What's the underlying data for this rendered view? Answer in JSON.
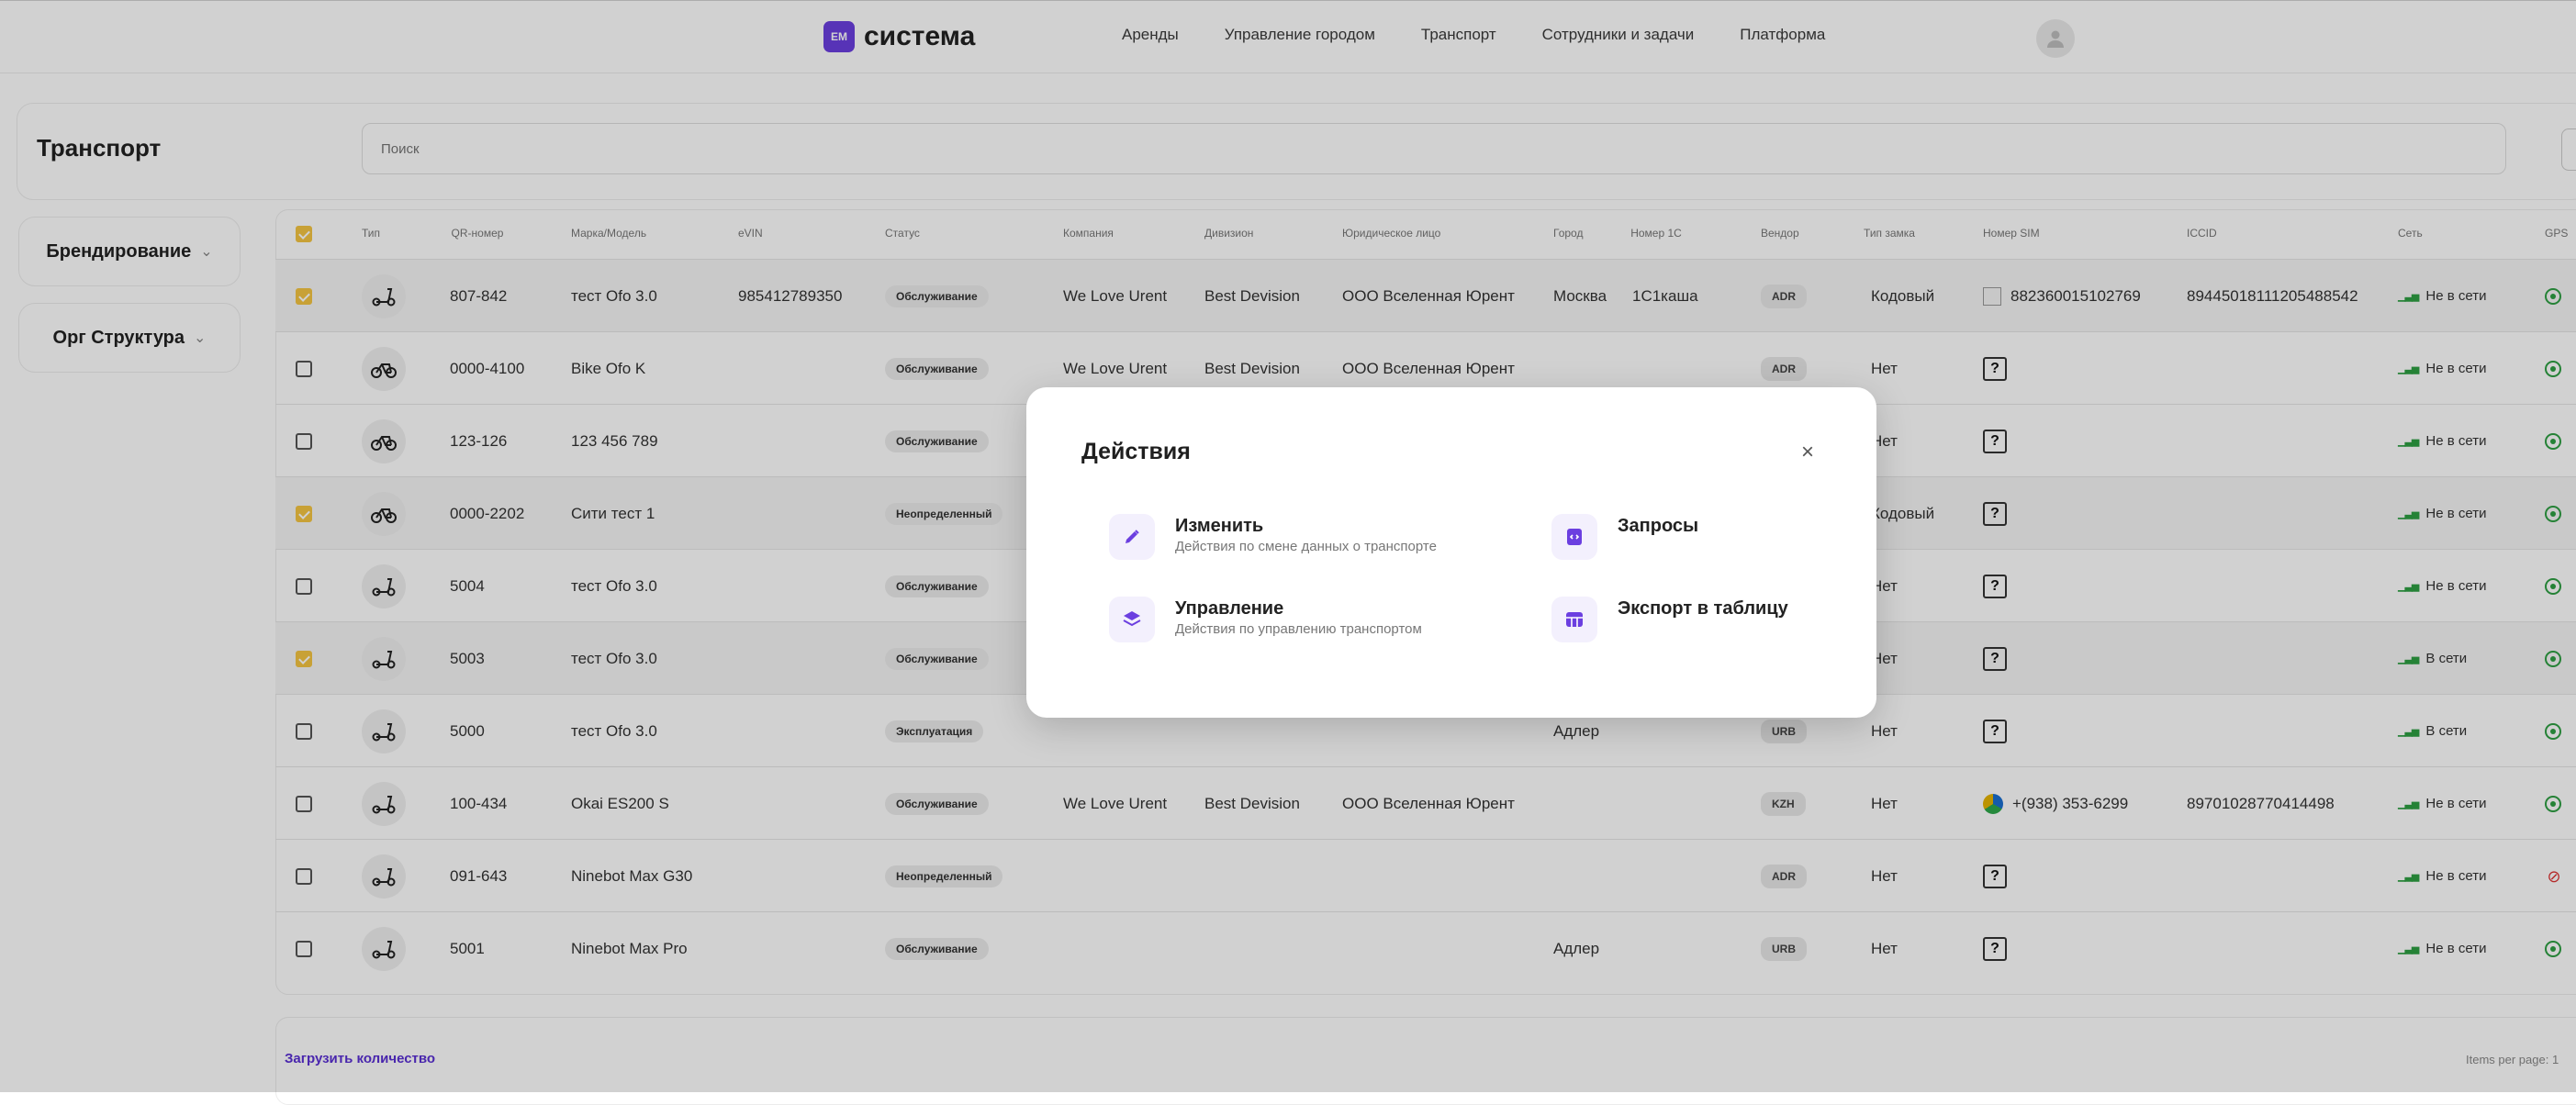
{
  "app": {
    "logo_badge": "EM",
    "logo_text": "система"
  },
  "nav": [
    "Аренды",
    "Управление городом",
    "Транспорт",
    "Сотрудники и задачи",
    "Платформа"
  ],
  "page": {
    "title": "Транспорт",
    "search_placeholder": "Поиск"
  },
  "sidebar": [
    {
      "label": "Брендирование"
    },
    {
      "label": "Орг Структура"
    }
  ],
  "columns": {
    "type": "Тип",
    "qr": "QR-номер",
    "model": "Марка/Модель",
    "evin": "eVIN",
    "status": "Статус",
    "company": "Компания",
    "division": "Дивизион",
    "legal": "Юридическое лицо",
    "city": "Город",
    "num1c": "Номер 1С",
    "vendor": "Вендор",
    "lock": "Тип замка",
    "sim": "Номер SIM",
    "iccid": "ICCID",
    "network": "Сеть",
    "gps": "GPS"
  },
  "rows": [
    {
      "selected": true,
      "icon": "scooter-icon",
      "qr": "807-842",
      "model": "тест Ofo 3.0",
      "evin": "985412789350",
      "status": "Обслуживание",
      "company": "We Love Urent",
      "division": "Best Devision",
      "legal": "ООО Вселенная Юрент",
      "city": "Москва",
      "num1c": "1С1каша",
      "vendor": "ADR",
      "lock": "Кодовый",
      "sim_kind": "image",
      "sim": "882360015102769",
      "iccid": "89445018111205488542",
      "network": "Не в сети",
      "gps": "on"
    },
    {
      "selected": false,
      "icon": "bike-icon",
      "qr": "0000-4100",
      "model": "Bike Ofo K",
      "evin": "",
      "status": "Обслуживание",
      "company": "We Love Urent",
      "division": "Best Devision",
      "legal": "ООО Вселенная Юрент",
      "city": "",
      "num1c": "",
      "vendor": "ADR",
      "lock": "Нет",
      "sim_kind": "unknown",
      "sim": "?",
      "iccid": "",
      "network": "Не в сети",
      "gps": "on"
    },
    {
      "selected": false,
      "icon": "bike-icon",
      "qr": "123-126",
      "model": "123 456 789",
      "evin": "",
      "status": "Обслуживание",
      "company": "",
      "division": "",
      "legal": "",
      "city": "",
      "num1c": "",
      "vendor": "",
      "lock": "Нет",
      "sim_kind": "unknown",
      "sim": "?",
      "iccid": "",
      "network": "Не в сети",
      "gps": "on"
    },
    {
      "selected": true,
      "icon": "bike-icon",
      "qr": "0000-2202",
      "model": "Сити тест 1",
      "evin": "",
      "status": "Неопределенный",
      "company": "",
      "division": "",
      "legal": "",
      "city": "",
      "num1c": "",
      "vendor": "",
      "lock": "Кодовый",
      "sim_kind": "unknown",
      "sim": "?",
      "iccid": "",
      "network": "Не в сети",
      "gps": "on"
    },
    {
      "selected": false,
      "icon": "scooter-icon",
      "qr": "5004",
      "model": "тест Ofo 3.0",
      "evin": "",
      "status": "Обслуживание",
      "company": "",
      "division": "",
      "legal": "",
      "city": "",
      "num1c": "",
      "vendor": "",
      "lock": "Нет",
      "sim_kind": "unknown",
      "sim": "?",
      "iccid": "",
      "network": "Не в сети",
      "gps": "on"
    },
    {
      "selected": true,
      "icon": "scooter-icon",
      "qr": "5003",
      "model": "тест Ofo 3.0",
      "evin": "",
      "status": "Обслуживание",
      "company": "",
      "division": "",
      "legal": "",
      "city": "",
      "num1c": "",
      "vendor": "",
      "lock": "Нет",
      "sim_kind": "unknown",
      "sim": "?",
      "iccid": "",
      "network": "В сети",
      "gps": "on"
    },
    {
      "selected": false,
      "icon": "scooter-icon",
      "qr": "5000",
      "model": "тест Ofo 3.0",
      "evin": "",
      "status": "Эксплуатация",
      "company": "",
      "division": "",
      "legal": "",
      "city": "Адлер",
      "num1c": "",
      "vendor": "URB",
      "lock": "Нет",
      "sim_kind": "unknown",
      "sim": "?",
      "iccid": "",
      "network": "В сети",
      "gps": "on"
    },
    {
      "selected": false,
      "icon": "scooter-icon",
      "qr": "100-434",
      "model": "Okai ES200 S",
      "evin": "",
      "status": "Обслуживание",
      "company": "We Love Urent",
      "division": "Best Devision",
      "legal": "ООО Вселенная Юрент",
      "city": "",
      "num1c": "",
      "vendor": "KZH",
      "lock": "Нет",
      "sim_kind": "flag",
      "sim": "+(938) 353-6299",
      "iccid": "89701028770414498",
      "network": "Не в сети",
      "gps": "on"
    },
    {
      "selected": false,
      "icon": "scooter-icon",
      "qr": "091-643",
      "model": "Ninebot Max G30",
      "evin": "",
      "status": "Неопределенный",
      "company": "",
      "division": "",
      "legal": "",
      "city": "",
      "num1c": "",
      "vendor": "ADR",
      "lock": "Нет",
      "sim_kind": "unknown",
      "sim": "?",
      "iccid": "",
      "network": "Не в сети",
      "gps": "off"
    },
    {
      "selected": false,
      "icon": "scooter-icon",
      "qr": "5001",
      "model": "Ninebot Max Pro",
      "evin": "",
      "status": "Обслуживание",
      "company": "",
      "division": "",
      "legal": "",
      "city": "Адлер",
      "num1c": "",
      "vendor": "URB",
      "lock": "Нет",
      "sim_kind": "unknown",
      "sim": "?",
      "iccid": "",
      "network": "Не в сети",
      "gps": "on"
    }
  ],
  "footer": {
    "load_more": "Загрузить количество",
    "items_per_page": "Items per page: 1"
  },
  "modal": {
    "title": "Действия",
    "actions": [
      {
        "title": "Изменить",
        "desc": "Действия по смене данных о транспорте",
        "icon": "pencil-icon"
      },
      {
        "title": "Запросы",
        "desc": "",
        "icon": "code-file-icon"
      },
      {
        "title": "Управление",
        "desc": "Действия по управлению транспортом",
        "icon": "layers-icon"
      },
      {
        "title": "Экспорт в таблицу",
        "desc": "",
        "icon": "table-icon"
      }
    ]
  },
  "colors": {
    "accent": "#6b3fe0",
    "checkbox": "#f5c542",
    "online": "#2e9f43",
    "gps_off": "#d33333"
  }
}
